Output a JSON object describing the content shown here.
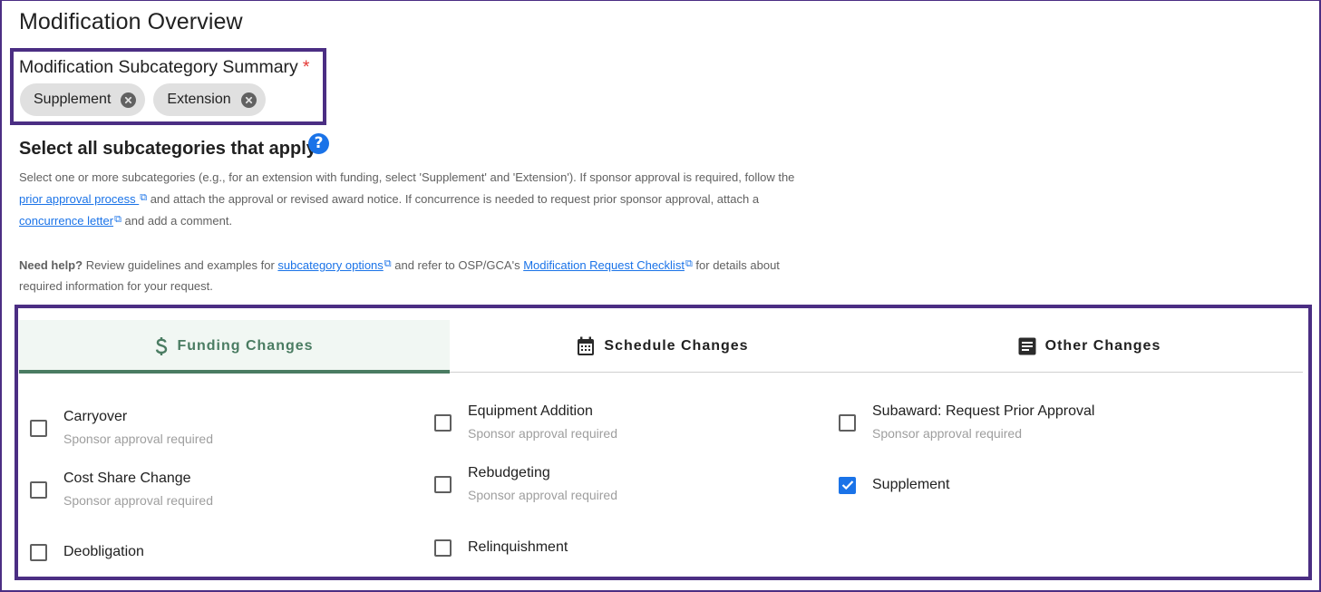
{
  "page": {
    "title": "Modification Overview"
  },
  "summary": {
    "label": "Modification Subcategory Summary",
    "required_marker": "*",
    "chips": [
      {
        "label": "Supplement",
        "icon": "close-circle-icon"
      },
      {
        "label": "Extension",
        "icon": "close-circle-icon"
      }
    ]
  },
  "instructions": {
    "heading": "Select all subcategories that apply",
    "help_icon": "help-circle-icon",
    "help_icon_glyph": "?",
    "desc_part1": "Select one or more subcategories (e.g., for an extension with funding, select 'Supplement' and 'Extension'). If sponsor approval is required, follow the ",
    "link_prior_approval": "prior approval process ",
    "desc_part2": " and attach the approval or revised award notice. If concurrence is needed to request prior sponsor approval, attach a ",
    "link_concurrence": "concurrence letter",
    "desc_part3": " and add a comment.",
    "external_link_glyph": "⧉",
    "need_help_bold": "Need help?",
    "help_part1": " Review guidelines and examples for ",
    "link_subcategory_options": "subcategory options",
    "help_part2": " and refer to OSP/GCA's ",
    "link_checklist": "Modification Request Checklist",
    "help_part3": "  for details about required information for your request."
  },
  "tabs": [
    {
      "label": "Funding Changes",
      "icon": "dollar-icon",
      "active": true
    },
    {
      "label": "Schedule Changes",
      "icon": "calendar-icon",
      "active": false
    },
    {
      "label": "Other Changes",
      "icon": "document-lines-icon",
      "active": false
    }
  ],
  "options": [
    {
      "label": "Carryover",
      "sub": "Sponsor approval required",
      "checked": false
    },
    {
      "label": "Cost Share Change",
      "sub": "Sponsor approval required",
      "checked": false
    },
    {
      "label": "Deobligation",
      "sub": "",
      "checked": false
    },
    {
      "label": "Equipment Addition",
      "sub": "Sponsor approval required",
      "checked": false
    },
    {
      "label": "Rebudgeting",
      "sub": "Sponsor approval required",
      "checked": false
    },
    {
      "label": "Relinquishment",
      "sub": "",
      "checked": false
    },
    {
      "label": "Subaward: Request Prior Approval",
      "sub": "Sponsor approval required",
      "checked": false
    },
    {
      "label": "Supplement",
      "sub": "",
      "checked": true
    }
  ],
  "colors": {
    "frame": "#4b2e83",
    "accent_green": "#4a7c62",
    "active_tab_bg": "#f1f7f3",
    "link_blue": "#1a73e8",
    "required_red": "#e53935",
    "checkbox_checked": "#1a73e8"
  }
}
